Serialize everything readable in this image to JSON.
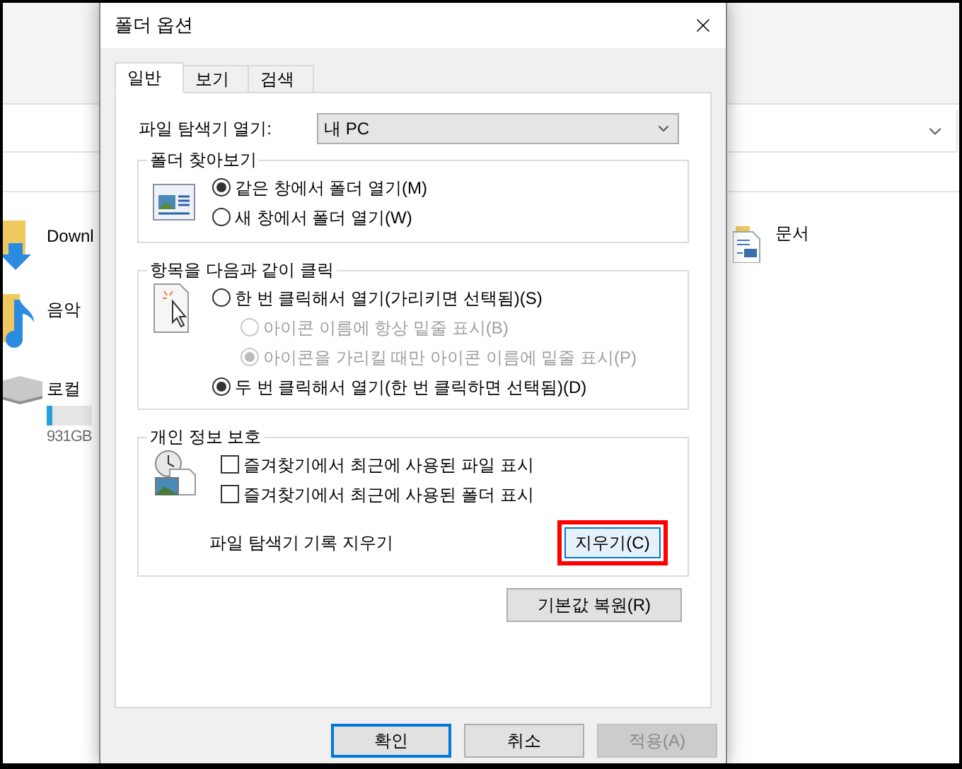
{
  "explorer": {
    "items": [
      {
        "kind": "download",
        "label": "Downl"
      },
      {
        "kind": "music",
        "label": "음악"
      },
      {
        "kind": "drive",
        "label": "로컬",
        "capacity": "931GB",
        "level": 0.12
      }
    ],
    "right_items": [
      {
        "kind": "documents",
        "label": "문서"
      }
    ]
  },
  "dialog": {
    "title": "폴더 옵션",
    "tabs": [
      {
        "label": "일반",
        "selected": true
      },
      {
        "label": "보기",
        "selected": false
      },
      {
        "label": "검색",
        "selected": false
      }
    ],
    "open_in": {
      "label": "파일 탐색기 열기:",
      "value": "내 PC"
    },
    "browse": {
      "title": "폴더 찾아보기",
      "options": [
        {
          "label": "같은 창에서 폴더 열기(M)",
          "selected": true
        },
        {
          "label": "새 창에서 폴더 열기(W)",
          "selected": false
        }
      ]
    },
    "click": {
      "title": "항목을 다음과 같이 클릭",
      "options": [
        {
          "label": "한 번 클릭해서 열기(가리키면 선택됨)(S)",
          "selected": false,
          "children": [
            {
              "label": "아이콘 이름에 항상 밑줄 표시(B)",
              "selected": false,
              "disabled": true
            },
            {
              "label": "아이콘을 가리킬 때만 아이콘 이름에 밑줄 표시(P)",
              "selected": true,
              "disabled": true
            }
          ]
        },
        {
          "label": "두 번 클릭해서 열기(한 번 클릭하면 선택됨)(D)",
          "selected": true
        }
      ]
    },
    "privacy": {
      "title": "개인 정보 보호",
      "checkboxes": [
        {
          "label": "즐겨찾기에서 최근에 사용된 파일 표시",
          "checked": false
        },
        {
          "label": "즐겨찾기에서 최근에 사용된 폴더 표시",
          "checked": false
        }
      ],
      "clear_label": "파일 탐색기 기록 지우기",
      "clear_button": "지우기(C)",
      "highlighted": true
    },
    "restore_button": "기본값 복원(R)",
    "buttons": [
      {
        "label": "확인",
        "kind": "default",
        "disabled": false
      },
      {
        "label": "취소",
        "kind": "normal",
        "disabled": false
      },
      {
        "label": "적용(A)",
        "kind": "normal",
        "disabled": true
      }
    ]
  }
}
